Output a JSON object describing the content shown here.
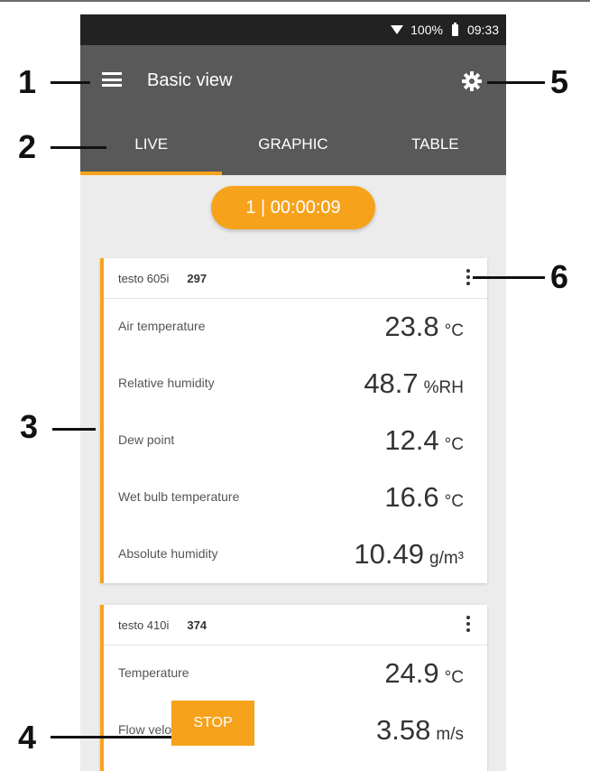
{
  "status": {
    "battery": "100%",
    "time": "09:33"
  },
  "header": {
    "title": "Basic view"
  },
  "tabs": [
    {
      "label": "LIVE"
    },
    {
      "label": "GRAPHIC"
    },
    {
      "label": "TABLE"
    }
  ],
  "timer": {
    "label": "1 | 00:00:09"
  },
  "cards": [
    {
      "device": "testo 605i",
      "serial": "297",
      "rows": [
        {
          "label": "Air temperature",
          "value": "23.8",
          "unit": "°C"
        },
        {
          "label": "Relative humidity",
          "value": "48.7",
          "unit": "%RH"
        },
        {
          "label": "Dew point",
          "value": "12.4",
          "unit": "°C"
        },
        {
          "label": "Wet bulb temperature",
          "value": "16.6",
          "unit": "°C"
        },
        {
          "label": "Absolute humidity",
          "value": "10.49",
          "unit": "g/m³"
        }
      ]
    },
    {
      "device": "testo 410i",
      "serial": "374",
      "rows": [
        {
          "label": "Temperature",
          "value": "24.9",
          "unit": "°C"
        },
        {
          "label": "Flow velocity",
          "value": "3.58",
          "unit": "m/s"
        }
      ]
    }
  ],
  "stop_button": {
    "label": "STOP"
  },
  "callouts": [
    "1",
    "2",
    "3",
    "4",
    "5",
    "6"
  ],
  "colors": {
    "accent": "#f7a21b",
    "header": "#595959",
    "statusbar": "#222222"
  },
  "icons": {
    "menu": "hamburger-icon",
    "settings": "gear-icon",
    "more": "kebab-icon",
    "wifi": "wifi-icon",
    "battery": "battery-icon"
  }
}
